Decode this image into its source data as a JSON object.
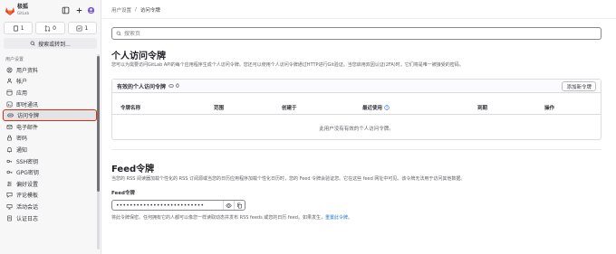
{
  "brand": {
    "name": "极狐",
    "subtitle": "GitLab"
  },
  "sidebar": {
    "counts": [
      {
        "icon": "issues-icon",
        "value": "1"
      },
      {
        "icon": "merge-request-icon",
        "value": "0"
      },
      {
        "icon": "todo-icon",
        "value": "1"
      }
    ],
    "search_label": "搜索或转到...",
    "section_heading": "用户设置",
    "items": [
      {
        "icon": "profile-icon",
        "label": "用户资料"
      },
      {
        "icon": "account-icon",
        "label": "帐户"
      },
      {
        "icon": "applications-icon",
        "label": "应用"
      },
      {
        "icon": "chat-icon",
        "label": "即时通讯"
      },
      {
        "icon": "token-icon",
        "label": "访问令牌",
        "active": true
      },
      {
        "icon": "email-icon",
        "label": "电子邮件"
      },
      {
        "icon": "password-icon",
        "label": "密码"
      },
      {
        "icon": "notification-icon",
        "label": "通知"
      },
      {
        "icon": "ssh-key-icon",
        "label": "SSH密钥"
      },
      {
        "icon": "gpg-key-icon",
        "label": "GPG密钥"
      },
      {
        "icon": "preferences-icon",
        "label": "偏好设置"
      },
      {
        "icon": "comment-template-icon",
        "label": "评论模板"
      },
      {
        "icon": "sessions-icon",
        "label": "活动会话"
      },
      {
        "icon": "auth-log-icon",
        "label": "认证日志"
      }
    ]
  },
  "breadcrumb": {
    "parent": "用户设置",
    "separator": "/",
    "current": "访问令牌"
  },
  "search": {
    "placeholder": "搜索页"
  },
  "tokens": {
    "title": "个人访问令牌",
    "description": "您可以为需要访问GitLab API的每个应用程序生成个人访问令牌。您还可以使用个人访问令牌通过HTTP进行Git验证。当您启用双因认证(2FA)时，它们将是唯一被接受的密码。",
    "card_title": "有效的个人访问令牌",
    "count": "0",
    "add_button": "添加新令牌",
    "columns": [
      "令牌名称",
      "范围",
      "创建于",
      "最近使用",
      "到期",
      "操作"
    ],
    "empty": "此用户没有有效的个人访问令牌。"
  },
  "feed": {
    "title": "Feed令牌",
    "description": "当您的 RSS 阅读器加载个性化的 RSS 订阅源或当您的日历应用程序加载个性化日历时，您的 Feed 令牌会验证您。它在这些 feed 网址中可见。该令牌无法用于访问其他数据。",
    "label": "Feed令牌",
    "value": "••••••••••••••••••••••••••",
    "help_text": "将此令牌保密。任何拥有它的人都可以像您一样读取动态并发布 RSS feeds 或您的日历 feed。如果发生，",
    "help_link": "重置此令牌",
    "help_end": "。"
  },
  "colors": {
    "accent": "#dd2b0e",
    "link": "#1f75cb",
    "sidebar_bg": "#f7f7f8"
  }
}
